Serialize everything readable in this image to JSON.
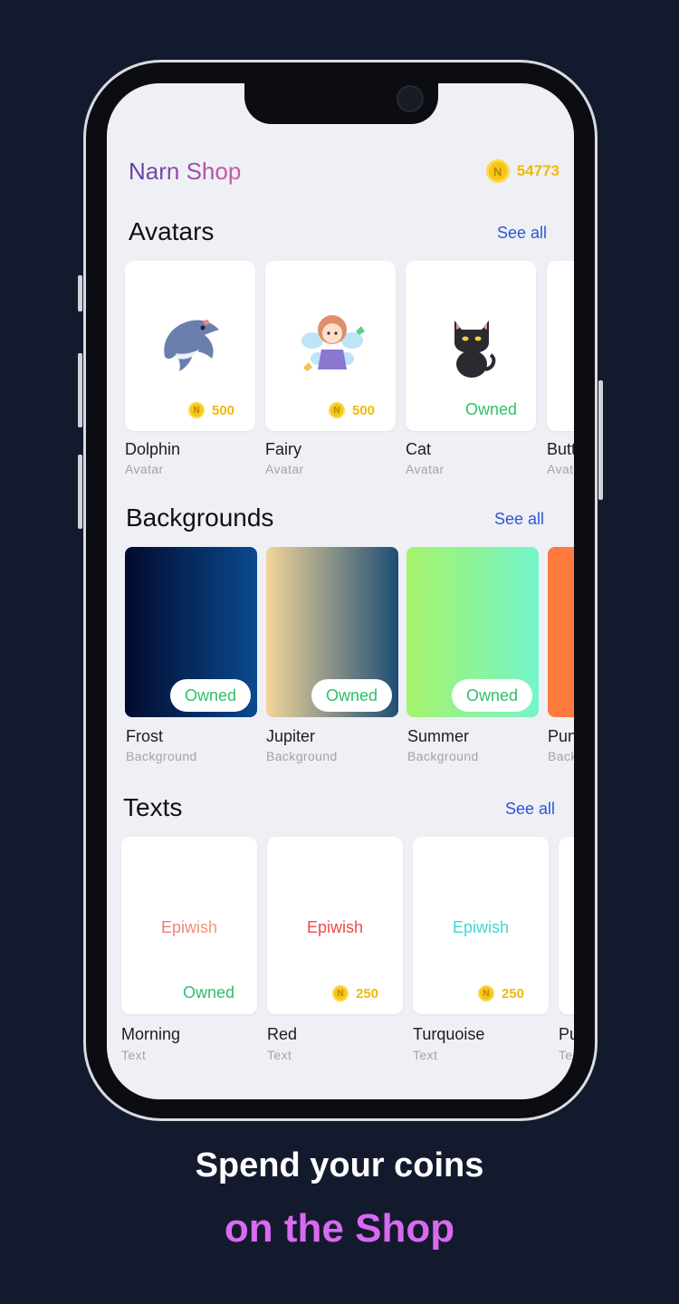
{
  "header": {
    "title": "Narn Shop",
    "coin_symbol": "N",
    "coin_balance": "54773"
  },
  "avatars": {
    "title": "Avatars",
    "see_all": "See all",
    "items": [
      {
        "name": "Dolphin",
        "type": "Avatar",
        "price": "500",
        "image_icon": "dolphin-icon"
      },
      {
        "name": "Fairy",
        "type": "Avatar",
        "price": "500",
        "image_icon": "fairy-icon"
      },
      {
        "name": "Cat",
        "type": "Avatar",
        "status": "Owned",
        "image_icon": "black-cat-icon"
      },
      {
        "name": "Butt",
        "type": "Avat"
      }
    ]
  },
  "backgrounds": {
    "title": "Backgrounds",
    "see_all": "See all",
    "items": [
      {
        "name": "Frost",
        "type": "Background",
        "status": "Owned",
        "colors": [
          "#020a2e",
          "#0a4a8f"
        ]
      },
      {
        "name": "Jupiter",
        "type": "Background",
        "status": "Owned",
        "colors": [
          "#f2d59a",
          "#1e4e75"
        ]
      },
      {
        "name": "Summer",
        "type": "Background",
        "status": "Owned",
        "colors": [
          "#a6f36a",
          "#74f5c9"
        ]
      },
      {
        "name": "Pun",
        "type": "Back",
        "colors": [
          "#ff7a3d",
          "#ff7a3d"
        ]
      }
    ]
  },
  "texts": {
    "title": "Texts",
    "see_all": "See all",
    "items": [
      {
        "name": "Morning",
        "type": "Text",
        "sample": "Epiwish",
        "status": "Owned",
        "color": "#f07a7a"
      },
      {
        "name": "Red",
        "type": "Text",
        "sample": "Epiwish",
        "price": "250",
        "color": "#f04a4a"
      },
      {
        "name": "Turquoise",
        "type": "Text",
        "sample": "Epiwish",
        "price": "250",
        "color": "#3ed8d8"
      },
      {
        "name": "Pu",
        "type": "Te"
      }
    ]
  },
  "caption": {
    "line1": "Spend your coins",
    "line2": "on the Shop"
  }
}
